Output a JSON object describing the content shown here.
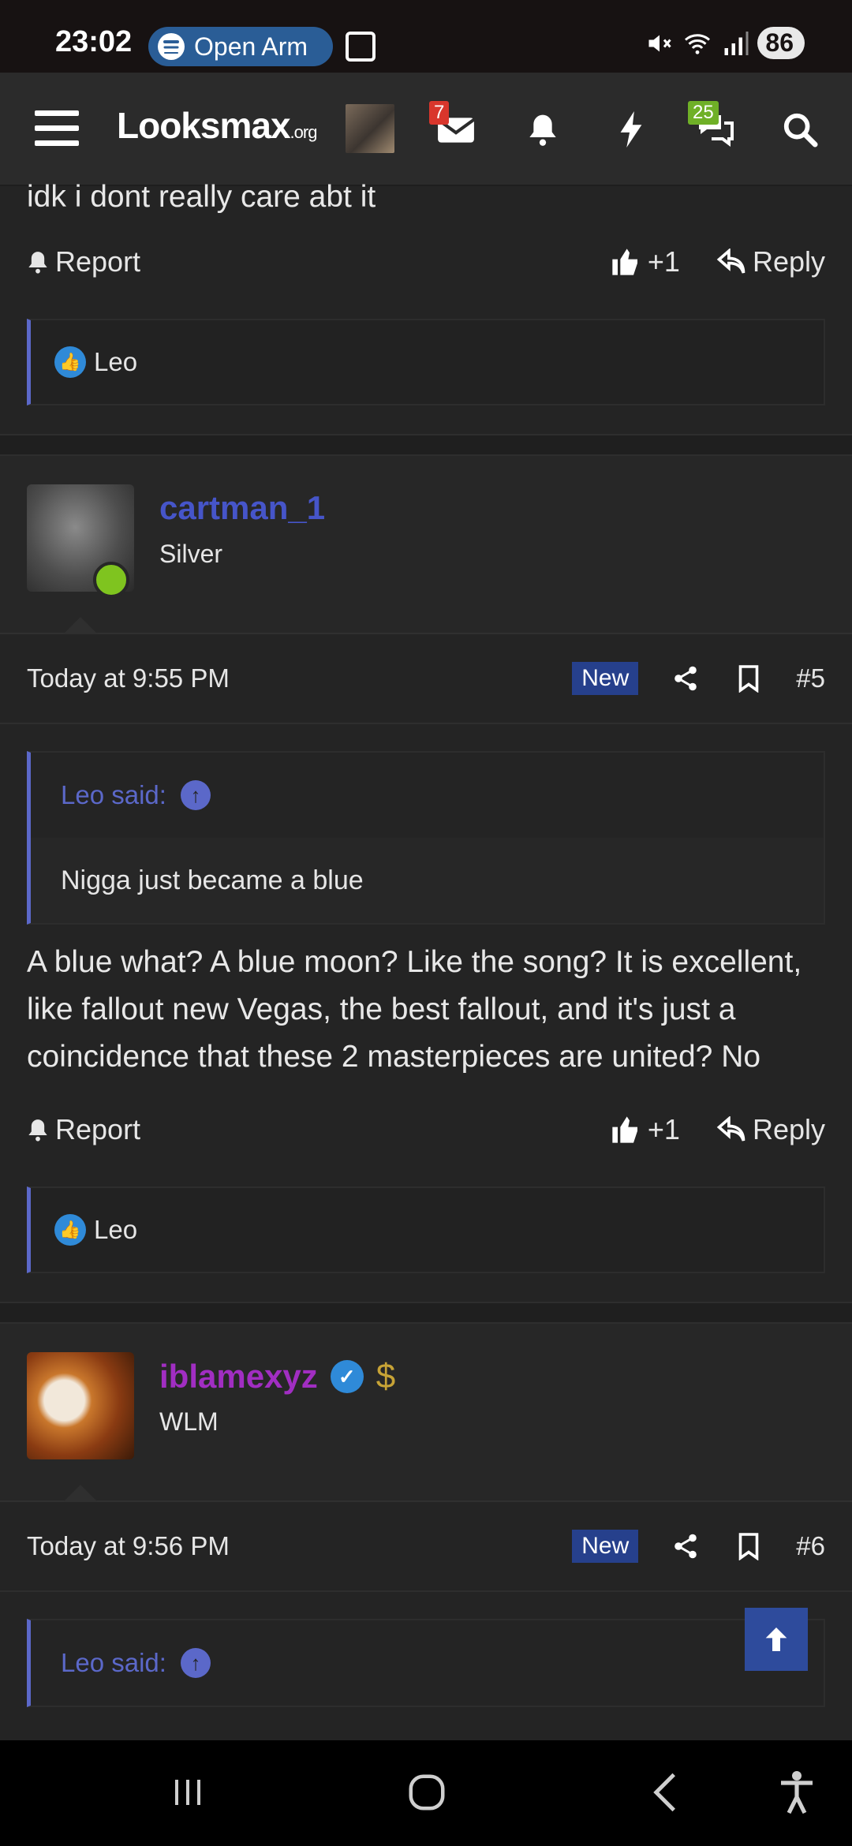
{
  "status_bar": {
    "time": "23:02",
    "media_label": "Open Arm",
    "battery": "86",
    "icons": [
      "mute-icon",
      "wifi-icon",
      "signal-icon"
    ]
  },
  "navbar": {
    "logo_main": "Looksmax",
    "logo_suffix": ".org",
    "inbox_count": "7",
    "chat_count": "25",
    "icons": [
      "menu-icon",
      "avatar",
      "mail-icon",
      "bell-icon",
      "lightning-icon",
      "chat-icon",
      "search-icon"
    ]
  },
  "post_top": {
    "text": "idk i dont really care abt it",
    "report_label": "Report",
    "like_label": "+1",
    "reply_label": "Reply",
    "reactions": "Leo"
  },
  "post5": {
    "username": "cartman_1",
    "user_title": "Silver",
    "timestamp": "Today at 9:55 PM",
    "new_label": "New",
    "number": "#5",
    "quote_author": "Leo said:",
    "quote_text": "Nigga just became a blue",
    "body": "A blue what? A blue moon? Like the song? It is excellent, like fallout new Vegas, the best fallout, and it's just a coincidence that these 2 masterpieces are united? No",
    "report_label": "Report",
    "like_label": "+1",
    "reply_label": "Reply",
    "reactions": "Leo",
    "colors": {
      "username": "#4655c9"
    }
  },
  "post6": {
    "username": "iblamexyz",
    "user_title": "WLM",
    "timestamp": "Today at 9:56 PM",
    "new_label": "New",
    "number": "#6",
    "quote_author": "Leo said:",
    "colors": {
      "username": "#a12ec2",
      "verified": "#2f8ad8",
      "dollar": "#c7a336"
    }
  },
  "colors": {
    "background": "#242424",
    "accent": "#5b68c9",
    "new_badge": "#26408c"
  }
}
